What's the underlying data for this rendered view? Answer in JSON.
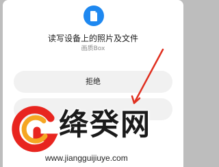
{
  "dialog": {
    "app_icon": "file-icon",
    "permission_text": "读写设备上的照片及文件",
    "app_name": "画质Box",
    "deny_label": "拒绝"
  },
  "watermark": {
    "name": "绛癸网",
    "url": "www.jiangguijiuye.com"
  },
  "colors": {
    "icon_blue": "#1e88f0",
    "annotation_red": "#e03020",
    "logo_red": "#e8251f",
    "logo_orange": "#f5a623"
  }
}
